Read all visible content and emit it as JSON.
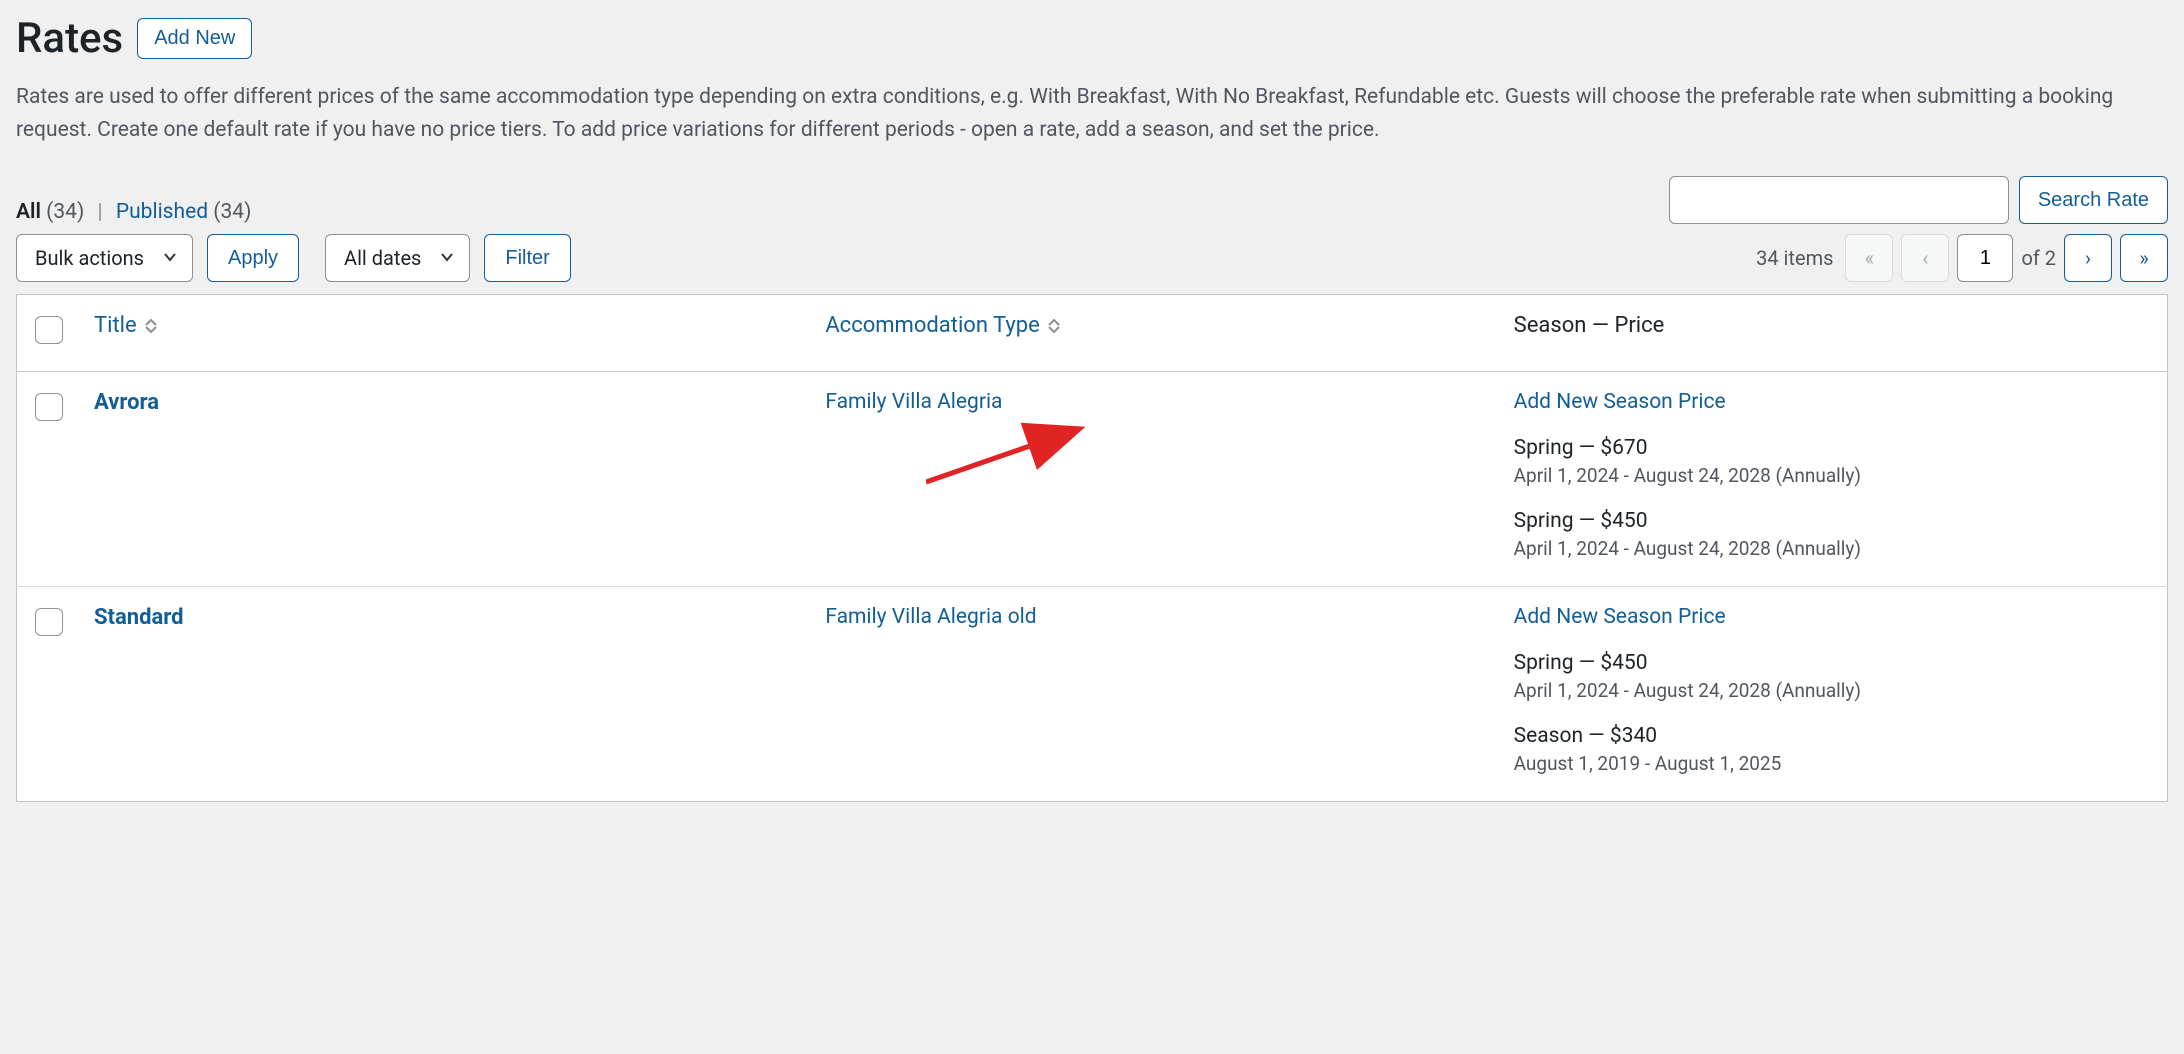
{
  "header": {
    "title": "Rates",
    "add_new": "Add New"
  },
  "intro": "Rates are used to offer different prices of the same accommodation type depending on extra conditions, e.g. With Breakfast, With No Breakfast, Refundable etc. Guests will choose the preferable rate when submitting a booking request. Create one default rate if you have no price tiers. To add price variations for different periods - open a rate, add a season, and set the price.",
  "views": {
    "all_label": "All",
    "all_count": "(34)",
    "published_label": "Published",
    "published_count": "(34)"
  },
  "search": {
    "button": "Search Rate"
  },
  "actions": {
    "bulk_label": "Bulk actions",
    "apply": "Apply",
    "dates_label": "All dates",
    "filter": "Filter"
  },
  "pagination": {
    "items_label": "34 items",
    "current": "1",
    "of_label": "of 2"
  },
  "columns": {
    "title": "Title",
    "accommodation": "Accommodation Type",
    "season_price": "Season — Price"
  },
  "add_season_link_label": "Add New Season Price",
  "rows": [
    {
      "title": "Avrora",
      "accommodation": "Family Villa Alegria",
      "seasons": [
        {
          "line": "Spring — $670",
          "sub": "April 1, 2024 - August 24, 2028 (Annually)"
        },
        {
          "line": "Spring — $450",
          "sub": "April 1, 2024 - August 24, 2028 (Annually)"
        }
      ]
    },
    {
      "title": "Standard",
      "accommodation": "Family Villa Alegria old",
      "seasons": [
        {
          "line": "Spring — $450",
          "sub": "April 1, 2024 - August 24, 2028 (Annually)"
        },
        {
          "line": "Season — $340",
          "sub": "August 1, 2019 - August 1, 2025"
        }
      ]
    }
  ]
}
